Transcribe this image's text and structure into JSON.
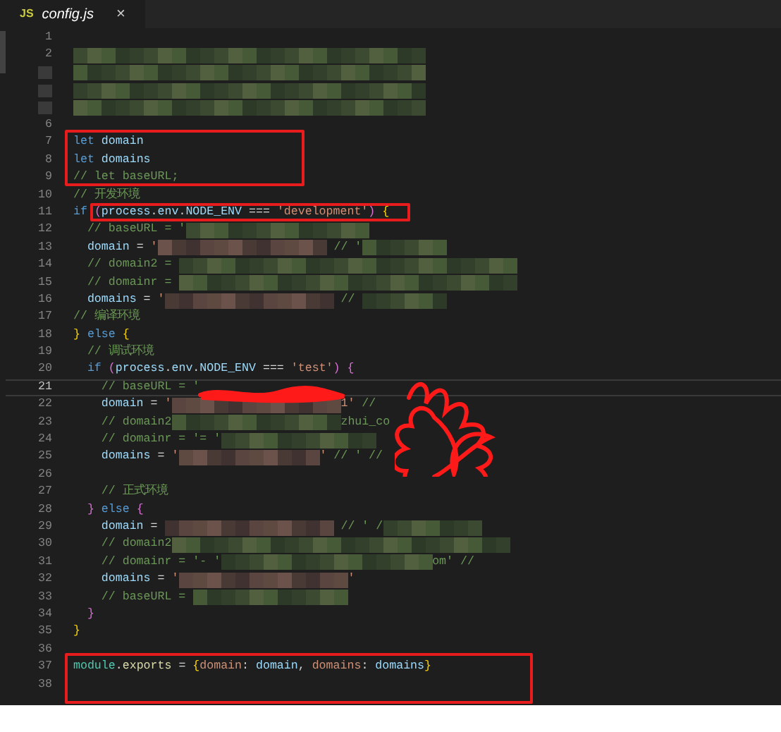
{
  "tab": {
    "icon_text": "JS",
    "title": "config.js",
    "close": "×",
    "selected": true
  },
  "lines": [
    {
      "number": "1",
      "current": false
    },
    {
      "number": "2",
      "current": false,
      "tokens": [
        {
          "kind": "redacted"
        }
      ]
    },
    {
      "current": false,
      "tokens": [
        {
          "kind": "redacted"
        }
      ]
    },
    {
      "current": false,
      "tokens": [
        {
          "kind": "redacted"
        }
      ]
    },
    {
      "current": false,
      "tokens": [
        {
          "kind": "redacted"
        }
      ]
    },
    {
      "number": "6",
      "current": false
    },
    {
      "number": "7",
      "current": false,
      "tokens": [
        {
          "kind": "keyword",
          "text": "let "
        },
        {
          "kind": "variable",
          "text": "domain"
        }
      ]
    },
    {
      "number": "8",
      "current": false,
      "tokens": [
        {
          "kind": "keyword",
          "text": "let "
        },
        {
          "kind": "variable",
          "text": "domains"
        }
      ]
    },
    {
      "number": "9",
      "current": false,
      "tokens": [
        {
          "kind": "comment",
          "text": "// let baseURL;"
        }
      ]
    },
    {
      "number": "10",
      "current": false,
      "tokens": [
        {
          "kind": "comment",
          "text": "// 开发环境"
        }
      ]
    },
    {
      "number": "11",
      "current": false,
      "tokens": [
        {
          "kind": "keyword",
          "text": "if "
        },
        {
          "kind": "brace2",
          "text": "("
        },
        {
          "kind": "variable",
          "text": "process"
        },
        {
          "kind": "plain",
          "text": "."
        },
        {
          "kind": "variable",
          "text": "env"
        },
        {
          "kind": "plain",
          "text": "."
        },
        {
          "kind": "variable",
          "text": "NODE_ENV"
        },
        {
          "kind": "plain",
          "text": " === "
        },
        {
          "kind": "string",
          "text": "'development'"
        },
        {
          "kind": "brace2",
          "text": ")"
        },
        {
          "kind": "brace1",
          "text": " {"
        }
      ]
    },
    {
      "number": "12",
      "current": false,
      "tokens": [
        {
          "kind": "comment",
          "text": "  // baseURL = '"
        },
        {
          "kind": "redacted"
        }
      ]
    },
    {
      "number": "13",
      "current": false,
      "tokens": [
        {
          "kind": "variable",
          "text": "  domain"
        },
        {
          "kind": "plain",
          "text": " = "
        },
        {
          "kind": "string",
          "text": "'"
        },
        {
          "kind": "redacted"
        },
        {
          "kind": "comment",
          "text": " // '"
        },
        {
          "kind": "redacted"
        }
      ]
    },
    {
      "number": "14",
      "current": false,
      "tokens": [
        {
          "kind": "comment",
          "text": "  // domain2 = "
        },
        {
          "kind": "redacted"
        }
      ]
    },
    {
      "number": "15",
      "current": false,
      "tokens": [
        {
          "kind": "comment",
          "text": "  // domainr = "
        },
        {
          "kind": "redacted"
        }
      ]
    },
    {
      "number": "16",
      "current": false,
      "tokens": [
        {
          "kind": "variable",
          "text": "  domains"
        },
        {
          "kind": "plain",
          "text": " = "
        },
        {
          "kind": "string",
          "text": "'"
        },
        {
          "kind": "redacted"
        },
        {
          "kind": "comment",
          "text": " // "
        },
        {
          "kind": "redacted"
        }
      ]
    },
    {
      "number": "17",
      "current": false,
      "tokens": [
        {
          "kind": "comment",
          "text": "// 编译环境"
        }
      ]
    },
    {
      "number": "18",
      "current": false,
      "tokens": [
        {
          "kind": "brace1",
          "text": "}"
        },
        {
          "kind": "keyword",
          "text": " else "
        },
        {
          "kind": "brace1",
          "text": "{"
        }
      ]
    },
    {
      "number": "19",
      "current": false,
      "tokens": [
        {
          "kind": "comment",
          "text": "  // 调试环境"
        }
      ]
    },
    {
      "number": "20",
      "current": false,
      "tokens": [
        {
          "kind": "keyword",
          "text": "  if "
        },
        {
          "kind": "brace2",
          "text": "("
        },
        {
          "kind": "variable",
          "text": "process"
        },
        {
          "kind": "plain",
          "text": "."
        },
        {
          "kind": "variable",
          "text": "env"
        },
        {
          "kind": "plain",
          "text": "."
        },
        {
          "kind": "variable",
          "text": "NODE_ENV"
        },
        {
          "kind": "plain",
          "text": " === "
        },
        {
          "kind": "string",
          "text": "'test'"
        },
        {
          "kind": "brace2",
          "text": ")"
        },
        {
          "kind": "brace2",
          "text": " {"
        }
      ]
    },
    {
      "number": "21",
      "current": true,
      "tokens": [
        {
          "kind": "comment",
          "text": "    // baseURL = '"
        }
      ]
    },
    {
      "number": "22",
      "current": false,
      "tokens": [
        {
          "kind": "variable",
          "text": "    domain"
        },
        {
          "kind": "plain",
          "text": " = "
        },
        {
          "kind": "string",
          "text": "'"
        },
        {
          "kind": "redacted"
        },
        {
          "kind": "string",
          "text": "1'"
        },
        {
          "kind": "comment",
          "text": " //"
        }
      ]
    },
    {
      "number": "23",
      "current": false,
      "tokens": [
        {
          "kind": "comment",
          "text": "    // domain2"
        },
        {
          "kind": "redacted"
        },
        {
          "kind": "comment",
          "text": "zhui_co"
        }
      ]
    },
    {
      "number": "24",
      "current": false,
      "tokens": [
        {
          "kind": "comment",
          "text": "    // domainr = '= '"
        },
        {
          "kind": "redacted"
        }
      ]
    },
    {
      "number": "25",
      "current": false,
      "tokens": [
        {
          "kind": "variable",
          "text": "    domains"
        },
        {
          "kind": "plain",
          "text": " = "
        },
        {
          "kind": "string",
          "text": "'"
        },
        {
          "kind": "redacted"
        },
        {
          "kind": "string",
          "text": "'"
        },
        {
          "kind": "comment",
          "text": " // ' //"
        }
      ]
    },
    {
      "number": "26",
      "current": false
    },
    {
      "number": "27",
      "current": false,
      "tokens": [
        {
          "kind": "comment",
          "text": "    // 正式环境"
        }
      ]
    },
    {
      "number": "28",
      "current": false,
      "tokens": [
        {
          "kind": "brace2",
          "text": "  }"
        },
        {
          "kind": "keyword",
          "text": " else "
        },
        {
          "kind": "brace2",
          "text": "{"
        }
      ]
    },
    {
      "number": "29",
      "current": false,
      "tokens": [
        {
          "kind": "variable",
          "text": "    domain"
        },
        {
          "kind": "plain",
          "text": " = "
        },
        {
          "kind": "redacted"
        },
        {
          "kind": "comment",
          "text": " // ' /"
        },
        {
          "kind": "redacted"
        }
      ]
    },
    {
      "number": "30",
      "current": false,
      "tokens": [
        {
          "kind": "comment",
          "text": "    // domain2"
        },
        {
          "kind": "redacted"
        }
      ]
    },
    {
      "number": "31",
      "current": false,
      "tokens": [
        {
          "kind": "comment",
          "text": "    // domainr = '- '"
        },
        {
          "kind": "redacted"
        },
        {
          "kind": "comment",
          "text": "om' //"
        }
      ]
    },
    {
      "number": "32",
      "current": false,
      "tokens": [
        {
          "kind": "variable",
          "text": "    domains"
        },
        {
          "kind": "plain",
          "text": " = "
        },
        {
          "kind": "string",
          "text": "'"
        },
        {
          "kind": "redacted"
        },
        {
          "kind": "string",
          "text": "'"
        }
      ]
    },
    {
      "number": "33",
      "current": false,
      "tokens": [
        {
          "kind": "comment",
          "text": "    // baseURL = "
        },
        {
          "kind": "redacted"
        }
      ]
    },
    {
      "number": "34",
      "current": false,
      "tokens": [
        {
          "kind": "brace2",
          "text": "  }"
        }
      ]
    },
    {
      "number": "35",
      "current": false,
      "tokens": [
        {
          "kind": "brace1",
          "text": "}"
        }
      ]
    },
    {
      "number": "36",
      "current": false
    },
    {
      "number": "37",
      "current": false,
      "tokens": [
        {
          "kind": "module",
          "text": "module"
        },
        {
          "kind": "plain",
          "text": "."
        },
        {
          "kind": "variable-light",
          "text": "exports"
        },
        {
          "kind": "plain",
          "text": " = "
        },
        {
          "kind": "brace1",
          "text": "{"
        },
        {
          "kind": "property",
          "text": "domain"
        },
        {
          "kind": "plain",
          "text": ": "
        },
        {
          "kind": "variable",
          "text": "domain"
        },
        {
          "kind": "plain",
          "text": ", "
        },
        {
          "kind": "property",
          "text": "domains"
        },
        {
          "kind": "plain",
          "text": ": "
        },
        {
          "kind": "variable",
          "text": "domains"
        },
        {
          "kind": "brace1",
          "text": "}"
        }
      ]
    },
    {
      "number": "38",
      "current": false
    }
  ],
  "annotations": [
    {
      "kind": "box"
    },
    {
      "kind": "box"
    },
    {
      "kind": "box"
    },
    {
      "kind": "scribble"
    },
    {
      "kind": "scribble"
    }
  ]
}
